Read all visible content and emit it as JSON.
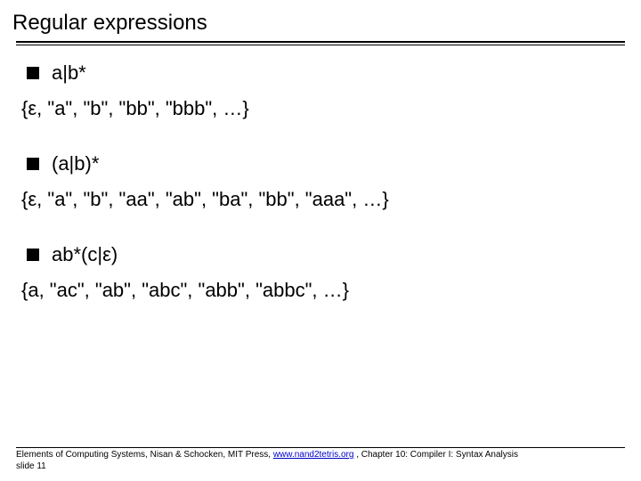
{
  "title": "Regular expressions",
  "items": [
    {
      "expr": "a|b*",
      "set": "{ε, \"a\", \"b\",  \"bb\", \"bbb\", …}"
    },
    {
      "expr": "(a|b)*",
      "set": "{ε, \"a\", \"b\",  \"aa\", \"ab\", \"ba\", \"bb\", \"aaa\", …}"
    },
    {
      "expr": "ab*(c|ε)",
      "set": "{a, \"ac\", \"ab\",  \"abc\", \"abb\", \"abbc\", …}"
    }
  ],
  "footer": {
    "book": "Elements of Computing Systems, Nisan & Schocken, MIT Press, ",
    "link_text": "www.nand2tetris.org",
    "chapter": " , Chapter 10: Compiler I: Syntax Analysis",
    "slide": "slide 11"
  }
}
